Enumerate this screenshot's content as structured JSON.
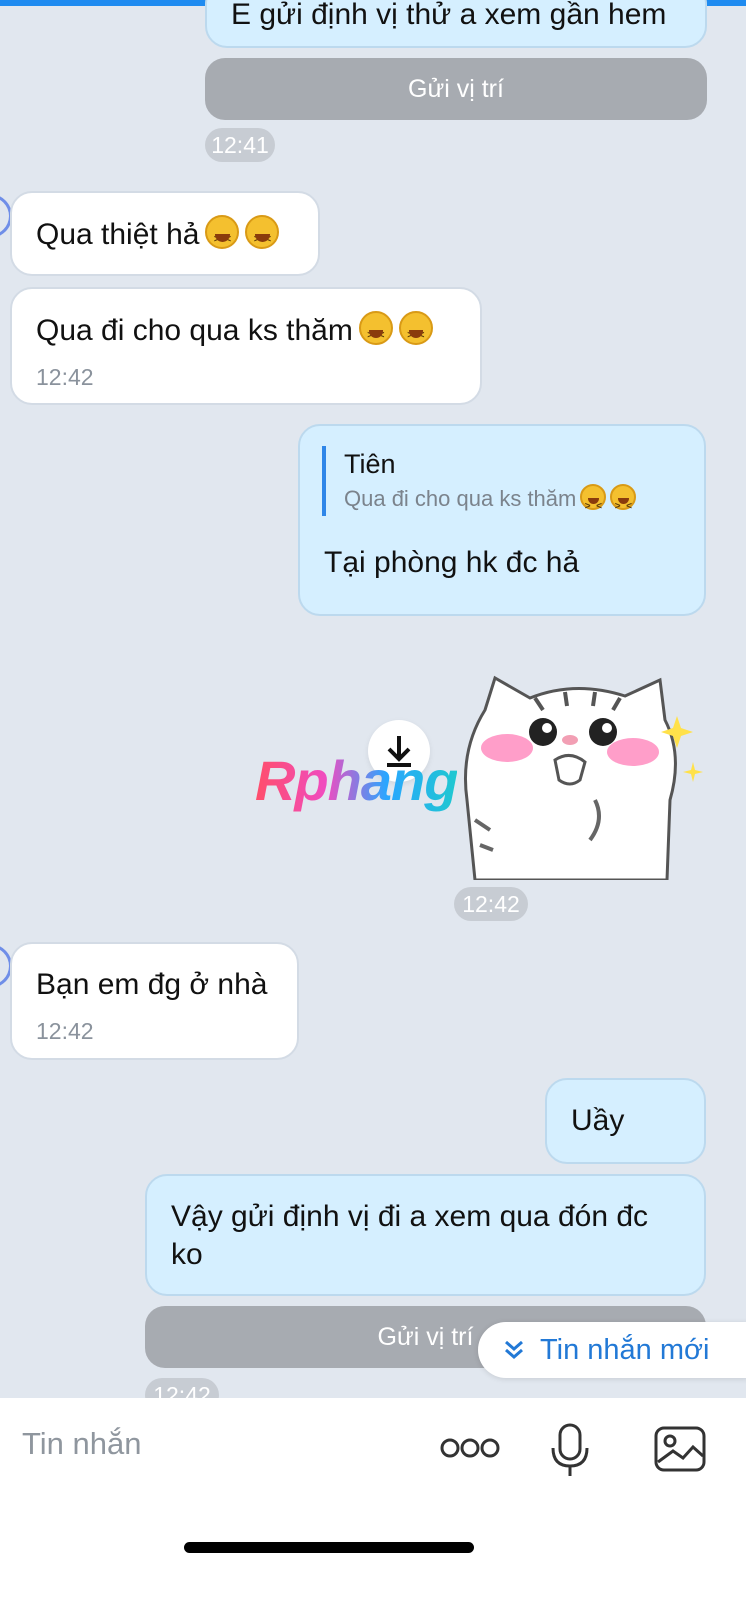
{
  "conversation": {
    "top_partial_text": "E gửi định vị thử a xem gần hem",
    "location_button_label": "Gửi vị trí",
    "time_1241": "12:41",
    "msg_qua_thiet_ha": "Qua thiệt hả",
    "msg_qua_di": "Qua đi cho qua ks thăm",
    "time_1242": "12:42",
    "reply": {
      "author": "Tiên",
      "quoted_text": "Qua đi cho qua ks thăm",
      "text": "Tại phòng hk đc hả"
    },
    "watermark": "Rphang",
    "msg_ban_em": "Bạn em đg ở nhà",
    "msg_uay": "Uầy",
    "msg_vay_line1": "Vậy gửi định vị đi a xem qua đón đc",
    "msg_vay_line2": "ko"
  },
  "new_message_pill": {
    "label": "Tin nhắn mới",
    "icon": "double-chevron-down-icon"
  },
  "composer": {
    "placeholder": "Tin nhắn",
    "icons": [
      "more-icon",
      "microphone-icon",
      "image-icon"
    ]
  },
  "colors": {
    "background": "#e1e7ef",
    "outgoing_bubble": "#d5efff",
    "incoming_bubble": "#ffffff",
    "accent": "#2279d6",
    "location_button": "#a7abb1"
  }
}
